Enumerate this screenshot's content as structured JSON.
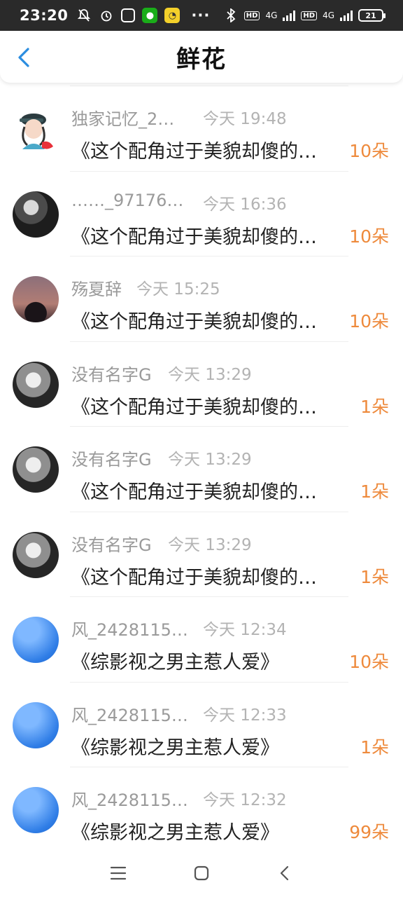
{
  "status_bar": {
    "time": "23:20",
    "dots": "···",
    "hd_1": "HD",
    "net_1": "4G",
    "hd_2": "HD",
    "net_2": "4G",
    "battery": "21"
  },
  "header": {
    "title": "鲜花",
    "back_icon": "chevron-left-icon"
  },
  "accent_color": "#ee8a3c",
  "back_color": "#2b8de0",
  "rows": [
    {
      "user": "独家记忆_2…",
      "time": "今天 19:48",
      "book": "《这个配角过于美貌却傻的…",
      "amount": "10朵",
      "avatar": "cartoon"
    },
    {
      "user": "……_97176…",
      "time": "今天 16:36",
      "book": "《这个配角过于美貌却傻的…",
      "amount": "10朵",
      "avatar": "dark"
    },
    {
      "user": "殇夏辞",
      "time": "今天 15:25",
      "book": "《这个配角过于美貌却傻的…",
      "amount": "10朵",
      "avatar": "dusk"
    },
    {
      "user": "没有名字G",
      "time": "今天 13:29",
      "book": "《这个配角过于美貌却傻的…",
      "amount": "1朵",
      "avatar": "girl"
    },
    {
      "user": "没有名字G",
      "time": "今天 13:29",
      "book": "《这个配角过于美貌却傻的…",
      "amount": "1朵",
      "avatar": "girl"
    },
    {
      "user": "没有名字G",
      "time": "今天 13:29",
      "book": "《这个配角过于美貌却傻的…",
      "amount": "1朵",
      "avatar": "girl"
    },
    {
      "user": "风_2428115…",
      "time": "今天 12:34",
      "book": "《综影视之男主惹人爱》",
      "amount": "10朵",
      "avatar": "sky"
    },
    {
      "user": "风_2428115…",
      "time": "今天 12:33",
      "book": "《综影视之男主惹人爱》",
      "amount": "1朵",
      "avatar": "sky"
    },
    {
      "user": "风_2428115…",
      "time": "今天 12:32",
      "book": "《综影视之男主惹人爱》",
      "amount": "99朵",
      "avatar": "sky"
    }
  ],
  "nav": {
    "menu_icon": "menu-icon",
    "home_icon": "home-icon",
    "back_icon": "back-icon"
  }
}
